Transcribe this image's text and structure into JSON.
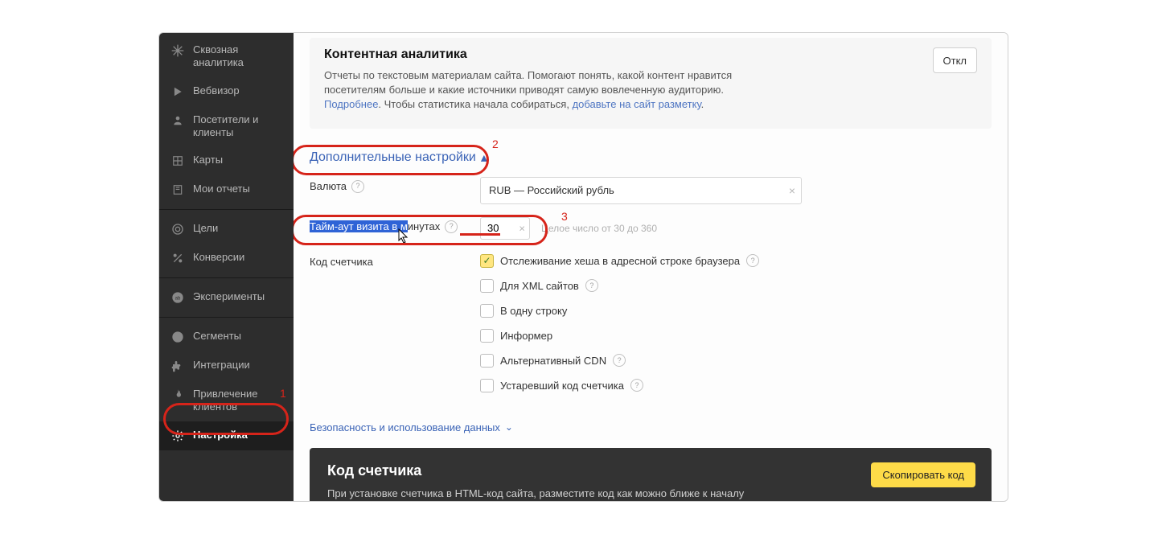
{
  "sidebar": {
    "items": [
      {
        "label": "Сквозная аналитика",
        "icon": "snowflake-icon"
      },
      {
        "label": "Вебвизор",
        "icon": "play-icon"
      },
      {
        "label": "Посетители и клиенты",
        "icon": "person-icon"
      },
      {
        "label": "Карты",
        "icon": "grid-icon"
      },
      {
        "label": "Мои отчеты",
        "icon": "bookmark-icon"
      },
      {
        "label": "Цели",
        "icon": "target-icon"
      },
      {
        "label": "Конверсии",
        "icon": "percent-icon"
      },
      {
        "label": "Эксперименты",
        "icon": "ab-icon"
      },
      {
        "label": "Сегменты",
        "icon": "pie-icon"
      },
      {
        "label": "Интеграции",
        "icon": "puzzle-icon"
      },
      {
        "label": "Привлечение клиентов",
        "icon": "flame-icon"
      },
      {
        "label": "Настройка",
        "icon": "gear-icon"
      }
    ]
  },
  "content_analytics": {
    "title": "Контентная аналитика",
    "body_1": "Отчеты по текстовым материалам сайта. Помогают понять, какой контент нравится посетителям больше и какие источники приводят самую вовлеченную аудиторию.",
    "link_more": "Подробнее",
    "body_2": ". Чтобы статистика начала собираться, ",
    "link_markup": "добавьте на сайт разметку",
    "body_3": ".",
    "toggle": "Откл"
  },
  "additional": {
    "title": "Дополнительные настройки",
    "currency_label": "Валюта",
    "currency_value": "RUB — Российский рубль",
    "timeout_label": "Тайм-аут визита в минутах",
    "timeout_value": "30",
    "timeout_hint": "Целое число от 30 до 360",
    "counter_label": "Код счетчика",
    "opts": {
      "hash": "Отслеживание хеша в адресной строке браузера",
      "xml": "Для XML сайтов",
      "oneline": "В одну строку",
      "informer": "Информер",
      "cdn": "Альтернативный CDN",
      "legacy": "Устаревший код счетчика"
    }
  },
  "security_link": "Безопасность и использование данных",
  "counter_box": {
    "title": "Код счетчика",
    "copy": "Скопировать код",
    "text": "При установке счетчика в HTML-код сайта, разместите код как можно ближе к началу"
  },
  "annotations": {
    "n1": "1",
    "n2": "2",
    "n3": "3"
  }
}
